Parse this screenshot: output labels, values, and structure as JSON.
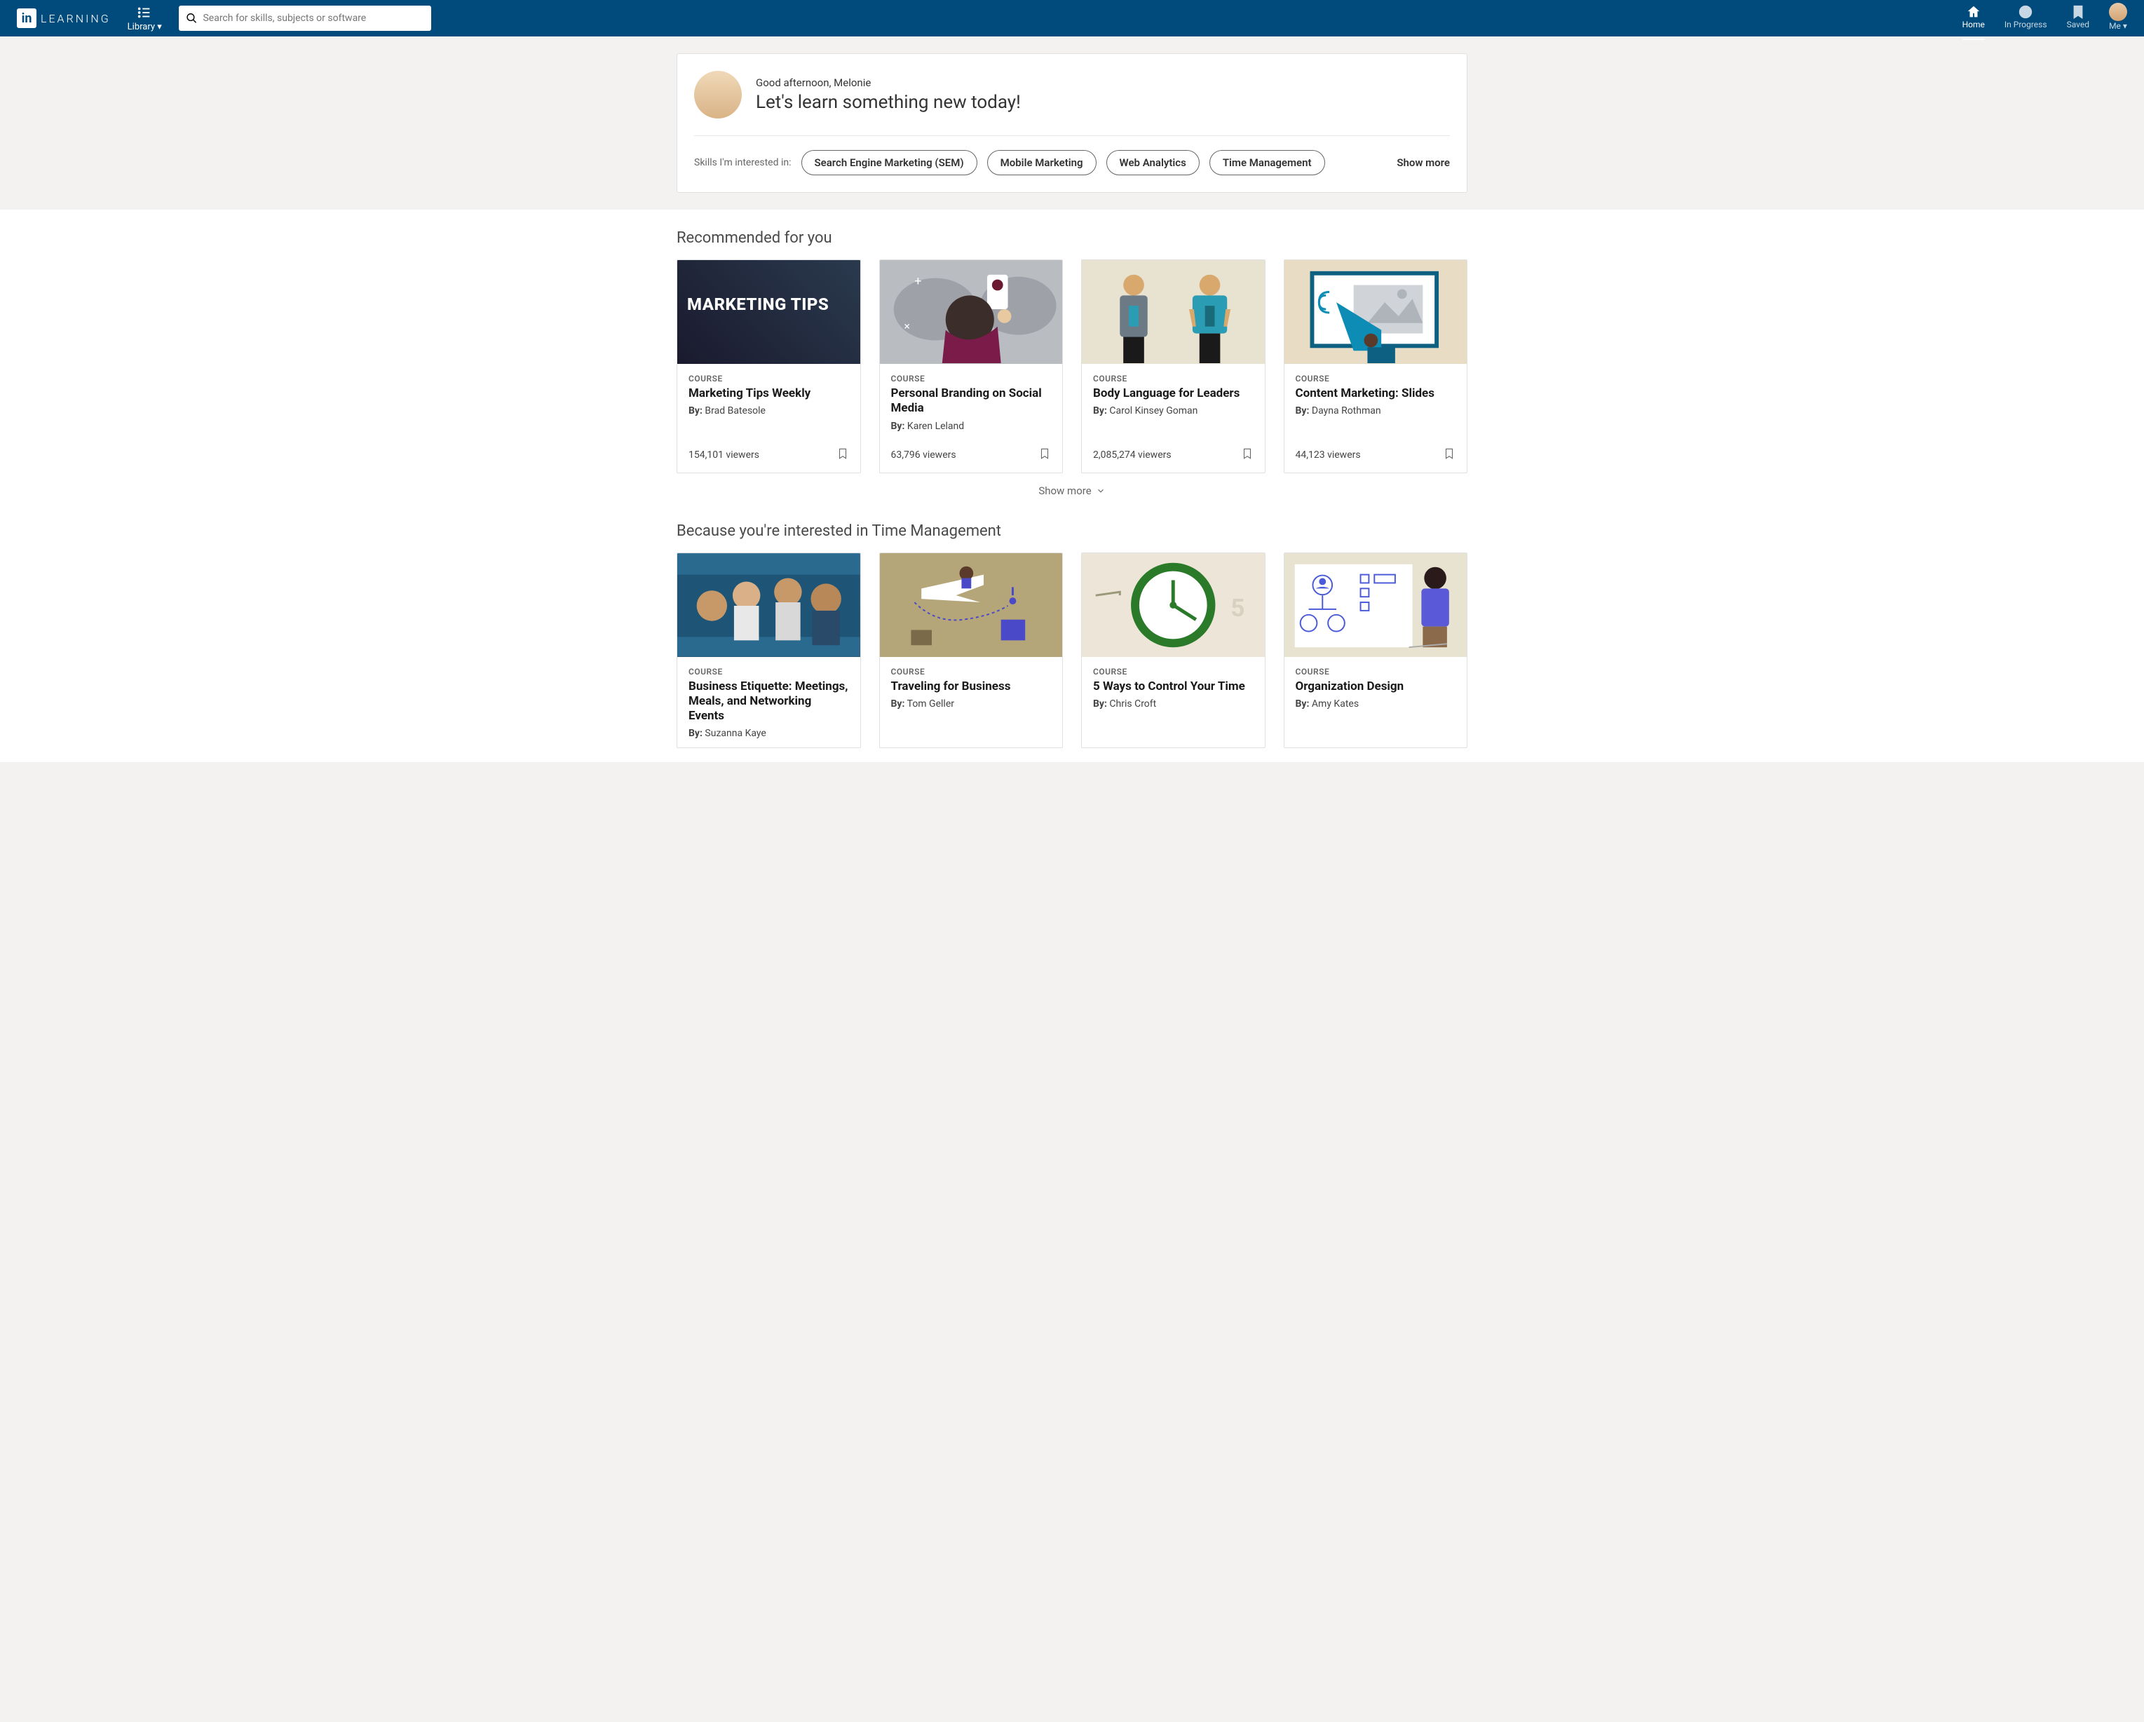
{
  "header": {
    "logo_text": "LEARNING",
    "library_label": "Library",
    "search_placeholder": "Search for skills, subjects or software",
    "nav": {
      "home": "Home",
      "in_progress": "In Progress",
      "saved": "Saved",
      "me": "Me"
    }
  },
  "welcome": {
    "greeting": "Good afternoon, Melonie",
    "headline": "Let's learn something new today!",
    "skills_label": "Skills I'm interested in:",
    "skills": [
      "Search Engine Marketing (SEM)",
      "Mobile Marketing",
      "Web Analytics",
      "Time Management"
    ],
    "show_more": "Show more"
  },
  "sections": {
    "recommended": {
      "title": "Recommended for you",
      "show_more": "Show more",
      "cards": [
        {
          "type": "COURSE",
          "title": "Marketing Tips Weekly",
          "by_label": "By:",
          "author": "Brad Batesole",
          "viewers": "154,101 viewers",
          "overlay": "MARKETING TIPS"
        },
        {
          "type": "COURSE",
          "title": "Personal Branding on Social Media",
          "by_label": "By:",
          "author": "Karen Leland",
          "viewers": "63,796 viewers"
        },
        {
          "type": "COURSE",
          "title": "Body Language for Leaders",
          "by_label": "By:",
          "author": "Carol Kinsey Goman",
          "viewers": "2,085,274 viewers"
        },
        {
          "type": "COURSE",
          "title": "Content Marketing: Slides",
          "by_label": "By:",
          "author": "Dayna Rothman",
          "viewers": "44,123 viewers"
        }
      ]
    },
    "time_mgmt": {
      "title": "Because you're interested in Time Management",
      "cards": [
        {
          "type": "COURSE",
          "title": "Business Etiquette: Meetings, Meals, and Networking Events",
          "by_label": "By:",
          "author": "Suzanna Kaye"
        },
        {
          "type": "COURSE",
          "title": "Traveling for Business",
          "by_label": "By:",
          "author": "Tom Geller"
        },
        {
          "type": "COURSE",
          "title": "5 Ways to Control Your Time",
          "by_label": "By:",
          "author": "Chris Croft"
        },
        {
          "type": "COURSE",
          "title": "Organization Design",
          "by_label": "By:",
          "author": "Amy Kates"
        }
      ]
    }
  }
}
